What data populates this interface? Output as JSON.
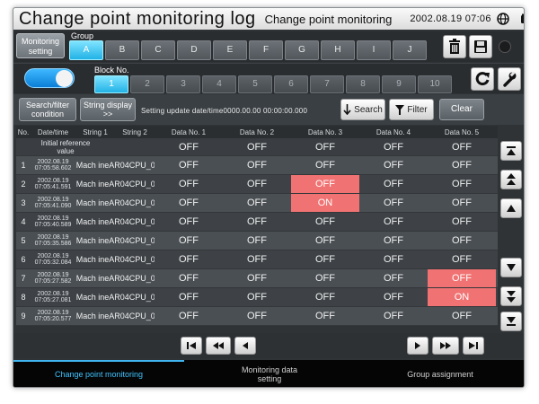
{
  "title": "Change point monitoring log",
  "subtitle": "Change point monitoring",
  "datetime": "2002.08.19 07:06",
  "monitoring_setting": "Monitoring setting",
  "group_label": "Group",
  "groups": [
    "A",
    "B",
    "C",
    "D",
    "E",
    "F",
    "G",
    "H",
    "I",
    "J"
  ],
  "block_label": "Block No.",
  "blocks": [
    "1",
    "2",
    "3",
    "4",
    "5",
    "6",
    "7",
    "8",
    "9",
    "10"
  ],
  "search_condition": "Search/filter condition",
  "string_display": "String display >>",
  "setting_update": "Setting update date/time0000.00.00  00:00:00.000",
  "search": "Search",
  "filter": "Filter",
  "clear": "Clear",
  "headers": [
    "No.",
    "Date/time",
    "String 1",
    "String 2",
    "Data No. 1",
    "Data No. 2",
    "Data No. 3",
    "Data No. 4",
    "Data No. 5"
  ],
  "initial": {
    "label_line1": "Initial reference",
    "label_line2": "value",
    "values": [
      "OFF",
      "OFF",
      "OFF",
      "OFF",
      "OFF"
    ]
  },
  "rows": [
    {
      "no": "1",
      "date": "2002.08.19",
      "time": "07:05:58.602",
      "s1": "Mach ineA",
      "s2": "R04CPU_0",
      "d": [
        "OFF",
        "OFF",
        "OFF",
        "OFF",
        "OFF"
      ]
    },
    {
      "no": "2",
      "date": "2002.08.19",
      "time": "07:05:41.591",
      "s1": "Mach ineA",
      "s2": "R04CPU_0",
      "d": [
        "OFF",
        "OFF",
        "OFF",
        "OFF",
        "OFF"
      ]
    },
    {
      "no": "3",
      "date": "2002.08.19",
      "time": "07:05:41.090",
      "s1": "Mach ineA",
      "s2": "R04CPU_0",
      "d": [
        "OFF",
        "OFF",
        "ON",
        "OFF",
        "OFF"
      ]
    },
    {
      "no": "4",
      "date": "2002.08.19",
      "time": "07:05:40.589",
      "s1": "Mach ineA",
      "s2": "R04CPU_0",
      "d": [
        "OFF",
        "OFF",
        "OFF",
        "OFF",
        "OFF"
      ]
    },
    {
      "no": "5",
      "date": "2002.08.19",
      "time": "07:05:35.586",
      "s1": "Mach ineA",
      "s2": "R04CPU_0",
      "d": [
        "OFF",
        "OFF",
        "OFF",
        "OFF",
        "OFF"
      ]
    },
    {
      "no": "6",
      "date": "2002.08.19",
      "time": "07:05:32.084",
      "s1": "Mach ineA",
      "s2": "R04CPU_0",
      "d": [
        "OFF",
        "OFF",
        "OFF",
        "OFF",
        "OFF"
      ]
    },
    {
      "no": "7",
      "date": "2002.08.19",
      "time": "07:05:27.582",
      "s1": "Mach ineA",
      "s2": "R04CPU_0",
      "d": [
        "OFF",
        "OFF",
        "OFF",
        "OFF",
        "OFF"
      ]
    },
    {
      "no": "8",
      "date": "2002.08.19",
      "time": "07:05:27.081",
      "s1": "Mach ineA",
      "s2": "R04CPU_0",
      "d": [
        "OFF",
        "OFF",
        "OFF",
        "OFF",
        "ON"
      ]
    },
    {
      "no": "9",
      "date": "2002.08.19",
      "time": "07:05:20.577",
      "s1": "Mach ineA",
      "s2": "R04CPU_0",
      "d": [
        "OFF",
        "OFF",
        "OFF",
        "OFF",
        "OFF"
      ]
    }
  ],
  "highlight_color": "#f07272",
  "accent_color": "#22b2e6",
  "footer": {
    "tab1": "Change point monitoring",
    "tab2_line1": "Monitoring data",
    "tab2_line2": "setting",
    "tab3": "Group assignment"
  }
}
